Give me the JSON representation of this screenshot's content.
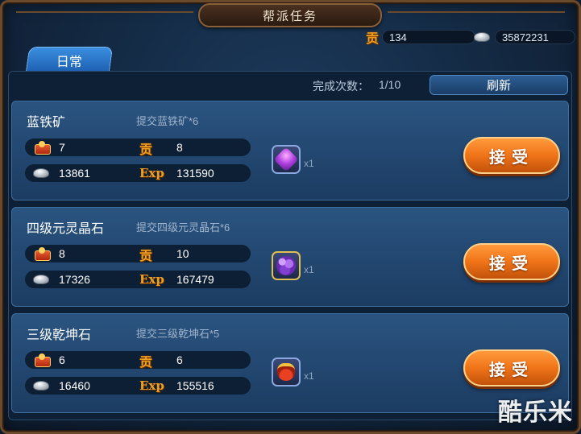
{
  "header": {
    "title": "帮派任务"
  },
  "currencies": {
    "contribution": {
      "icon": "contribution-icon",
      "glyph": "贡",
      "value": "134"
    },
    "silver": {
      "icon": "silver-ingot-icon",
      "value": "35872231"
    }
  },
  "tabs": [
    {
      "label": "日常",
      "active": true
    }
  ],
  "summary": {
    "count_label": "完成次数：",
    "count_value": "1/10",
    "refresh_label": "刷新"
  },
  "tasks": [
    {
      "name": "蓝铁矿",
      "requirement": "提交蓝铁矿*6",
      "reward_item_icon": "red-packet-icon",
      "reward_item_value": "7",
      "contribution_glyph": "贡",
      "contribution_value": "8",
      "silver_value": "13861",
      "exp_label": "Exp",
      "exp_value": "131590",
      "item_icon": "purple-gem-icon",
      "item_qty": "x1",
      "accept_label": "接受"
    },
    {
      "name": "四级元灵晶石",
      "requirement": "提交四级元灵晶石*6",
      "reward_item_icon": "red-pouch-icon",
      "reward_item_value": "8",
      "contribution_glyph": "贡",
      "contribution_value": "10",
      "silver_value": "17326",
      "exp_label": "Exp",
      "exp_value": "167479",
      "item_icon": "purple-grape-crystal-icon",
      "item_qty": "x1",
      "accept_label": "接受"
    },
    {
      "name": "三级乾坤石",
      "requirement": "提交三级乾坤石*5",
      "reward_item_icon": "red-pouch-icon",
      "reward_item_value": "6",
      "contribution_glyph": "贡",
      "contribution_value": "6",
      "silver_value": "16460",
      "exp_label": "Exp",
      "exp_value": "155516",
      "item_icon": "treasure-pouch-icon",
      "item_qty": "x1",
      "accept_label": "接受"
    }
  ],
  "watermark": "酷乐米"
}
